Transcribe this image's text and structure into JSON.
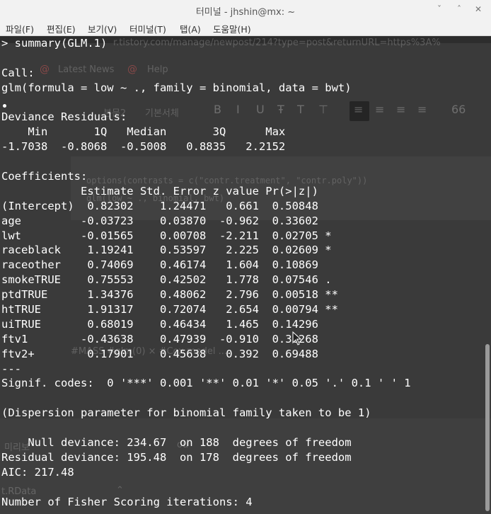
{
  "window": {
    "title": "터미널 - jhshin@mx: ~",
    "controls": {
      "minimize": "ˇ",
      "maximize": "ˆ",
      "close": "✕"
    }
  },
  "menu": [
    "파일(F)",
    "편집(E)",
    "보기(V)",
    "터미널(T)",
    "탭(A)",
    "도움말(H)"
  ],
  "background": {
    "url": "r.tistory.com/manage/newpost/214?type=post&returnURL=https%3A%",
    "tabs": [
      "Latest News",
      "Help"
    ],
    "toolbar": {
      "style": "본문2",
      "font": "기본서체"
    },
    "code_line1": "options(contrasts = c(\"contr.treatment\", \"contr.poly\"))",
    "code_line2": "glm(low ~ ., binomial, bwt)",
    "tags": "#MASS  #glm(0)  ×  #Cox model  ...",
    "bottom_left": "미리보",
    "bottom_file": "t.RData",
    "bottom_mid": "ou"
  },
  "terminal": {
    "lines": [
      "> summary(GLM.1)",
      "",
      "Call:",
      "glm(formula = low ~ ., family = binomial, data = bwt)",
      "",
      "Deviance Residuals: ",
      "    Min       1Q   Median       3Q      Max  ",
      "-1.7038  -0.8068  -0.5008   0.8835   2.2152  ",
      "",
      "Coefficients:",
      "            Estimate Std. Error z value Pr(>|z|)   ",
      "(Intercept)  0.82302    1.24471   0.661  0.50848   ",
      "age         -0.03723    0.03870  -0.962  0.33602   ",
      "lwt         -0.01565    0.00708  -2.211  0.02705 * ",
      "raceblack    1.19241    0.53597   2.225  0.02609 * ",
      "raceother    0.74069    0.46174   1.604  0.10869   ",
      "smokeTRUE    0.75553    0.42502   1.778  0.07546 . ",
      "ptdTRUE      1.34376    0.48062   2.796  0.00518 **",
      "htTRUE       1.91317    0.72074   2.654  0.00794 **",
      "uiTRUE       0.68019    0.46434   1.465  0.14296   ",
      "ftv1        -0.43638    0.47939  -0.910  0.36268   ",
      "ftv2+        0.17901    0.45638   0.392  0.69488   ",
      "---",
      "Signif. codes:  0 '***' 0.001 '**' 0.01 '*' 0.05 '.' 0.1 ' ' 1",
      "",
      "(Dispersion parameter for binomial family taken to be 1)",
      "",
      "    Null deviance: 234.67  on 188  degrees of freedom",
      "Residual deviance: 195.48  on 178  degrees of freedom",
      "AIC: 217.48",
      "",
      "Number of Fisher Scoring iterations: 4"
    ]
  },
  "colors": {
    "terminal_bg": "#3a3a3a",
    "terminal_fg": "#ffffff",
    "titlebar_bg": "#f2f2f2"
  }
}
